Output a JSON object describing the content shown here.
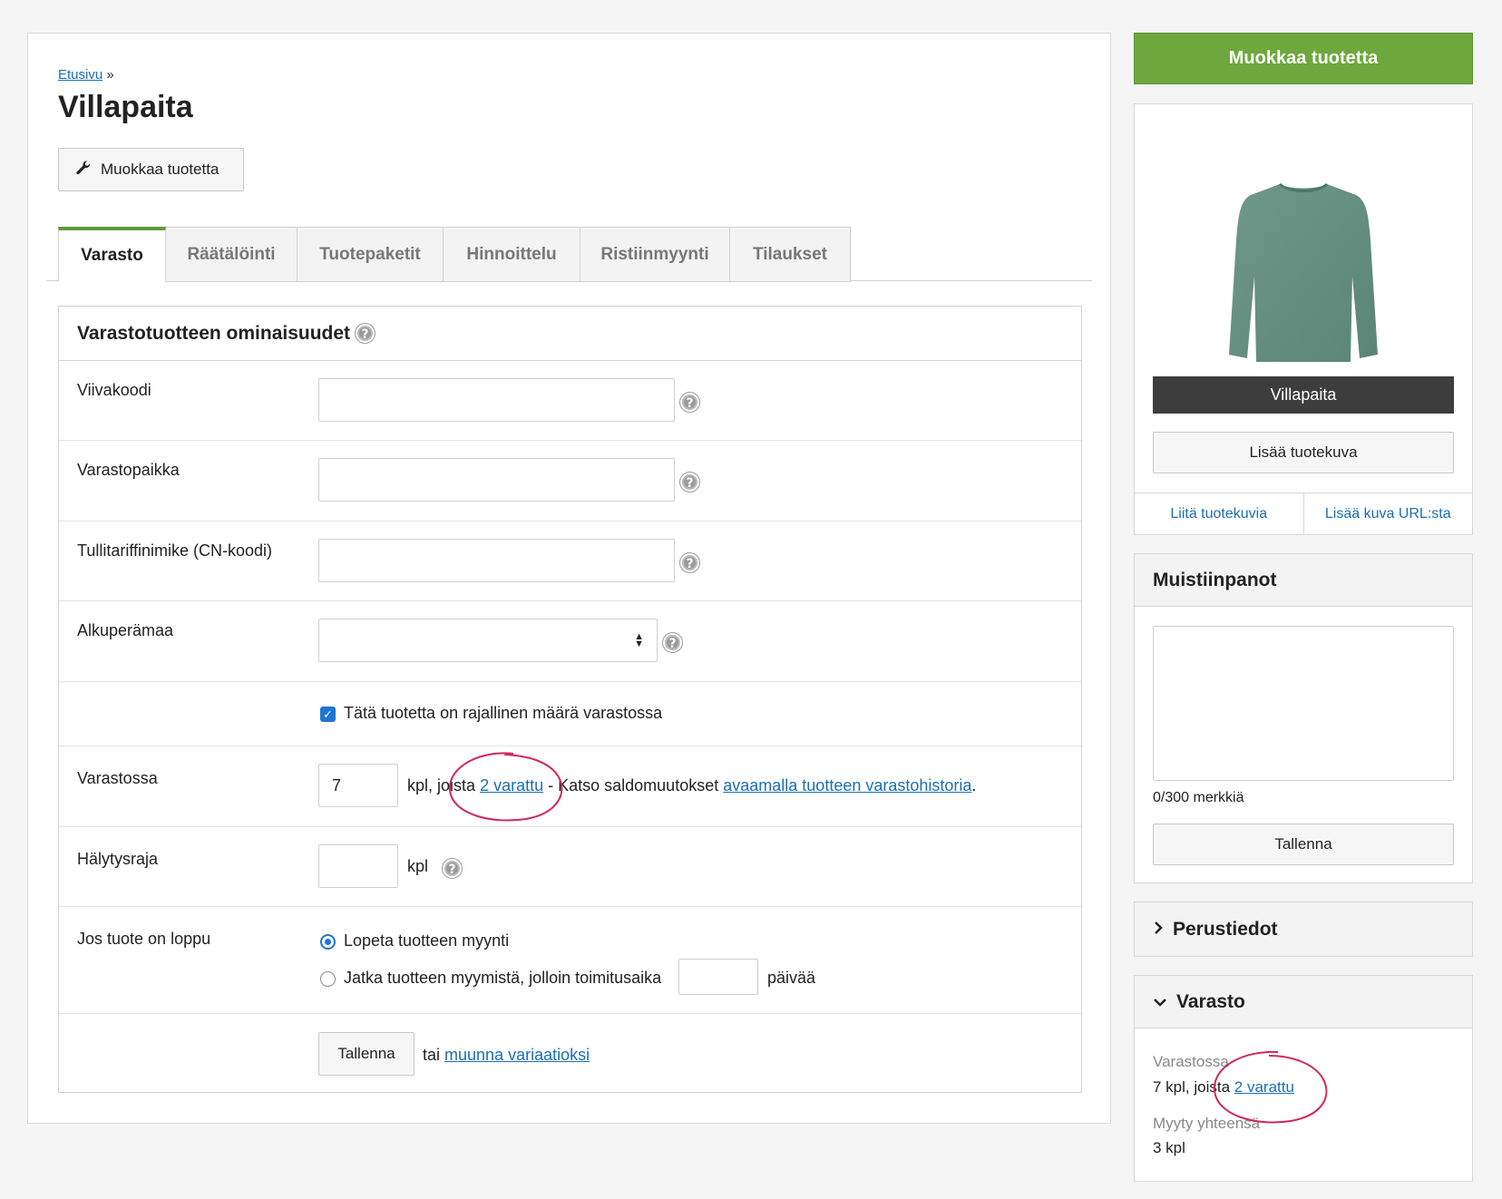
{
  "breadcrumb": {
    "home": "Etusivu",
    "sep": "»"
  },
  "page_title": "Villapaita",
  "edit_button_small": "Muokkaa tuotetta",
  "tabs": [
    "Varasto",
    "Räätälöinti",
    "Tuotepaketit",
    "Hinnoittelu",
    "Ristiinmyynti",
    "Tilaukset"
  ],
  "section": {
    "title": "Varastotuotteen ominaisuudet",
    "fields": {
      "barcode": "Viivakoodi",
      "location": "Varastopaikka",
      "cn_code": "Tullitariffinimike (CN-koodi)",
      "origin": "Alkuperämaa"
    },
    "limited_stock_label": "Tätä tuotetta on rajallinen määrä varastossa",
    "stock": {
      "label": "Varastossa",
      "value": "7",
      "text_before": "kpl, joista",
      "reserved_link": "2 varattu",
      "text_middle": "- Katso saldomuutokset",
      "history_link": "avaamalla tuotteen varastohistoria",
      "text_after": "."
    },
    "alert": {
      "label": "Hälytysraja",
      "value": "",
      "unit": "kpl"
    },
    "out_of_stock": {
      "label": "Jos tuote on loppu",
      "option_stop": "Lopeta tuotteen myynti",
      "option_continue": "Jatka tuotteen myymistä, jolloin toimitusaika",
      "days_value": "",
      "days_unit": "päivää"
    },
    "save_button": "Tallenna",
    "or_text": "tai",
    "variation_link": "muunna variaatioksi"
  },
  "sidebar": {
    "edit_button": "Muokkaa tuotetta",
    "image_name": "Villapaita",
    "add_image_button": "Lisää tuotekuva",
    "attach_images_link": "Liitä tuotekuvia",
    "add_url_link": "Lisää kuva URL:sta",
    "notes": {
      "title": "Muistiinpanot",
      "value": "",
      "counter": "0/300 merkkiä",
      "save_button": "Tallenna"
    },
    "basic_info_title": "Perustiedot",
    "stock": {
      "title": "Varasto",
      "in_stock_label": "Varastossa",
      "in_stock_prefix": "7 kpl, joista",
      "reserved_link": "2 varattu",
      "sold_label": "Myyty yhteensä",
      "sold_value": "3 kpl"
    }
  },
  "colors": {
    "accent_green": "#6ea83d",
    "link_blue": "#1a6fb3",
    "annotation": "#d0285a",
    "checkbox_blue": "#1e75d3"
  }
}
